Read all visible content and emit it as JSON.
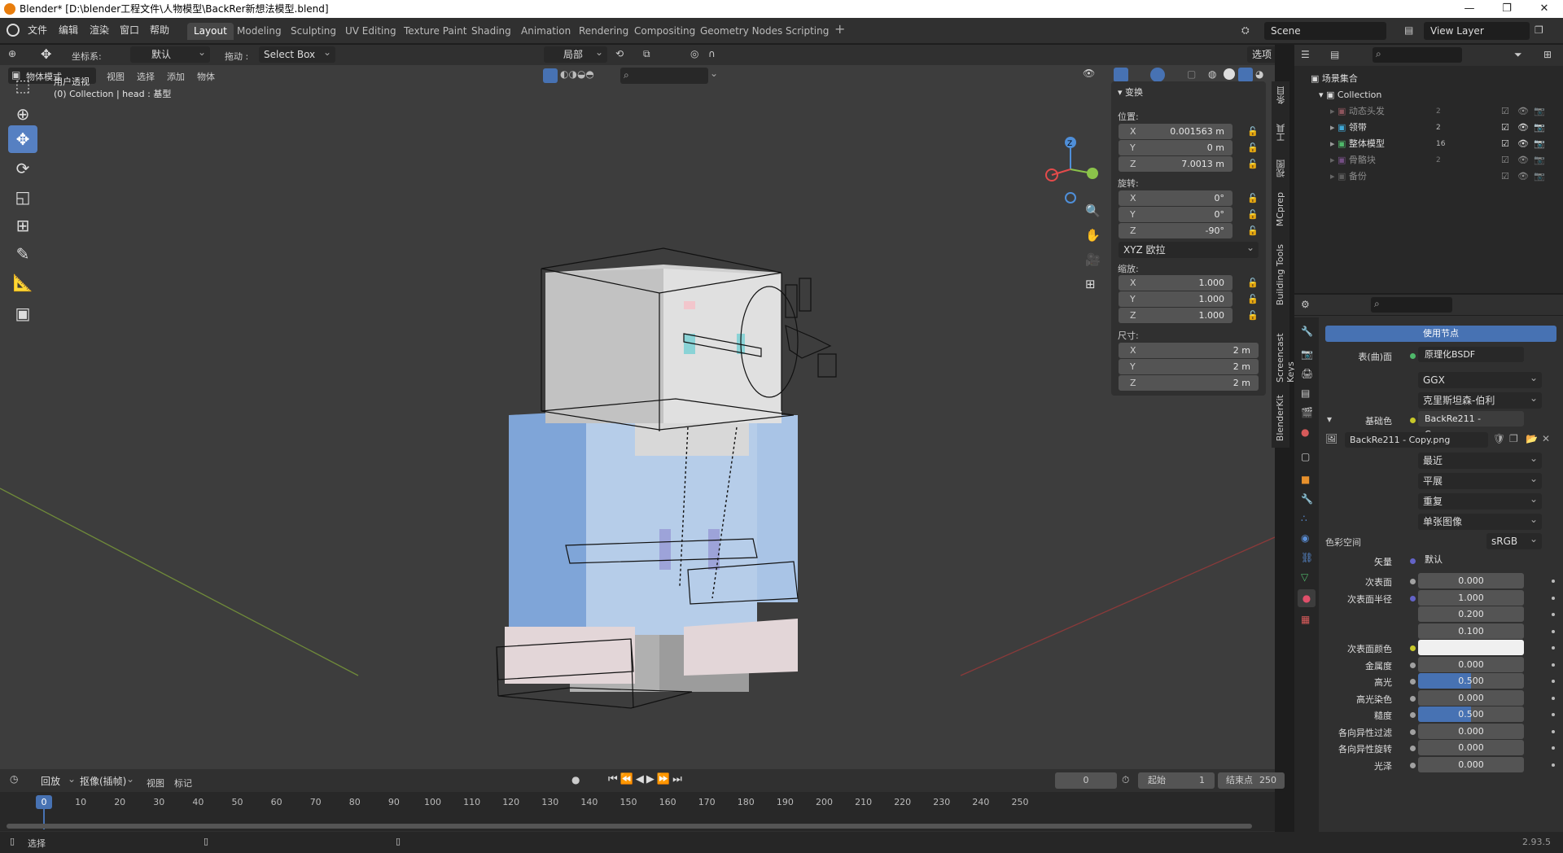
{
  "window": {
    "title": "Blender* [D:\\blender工程文件\\人物模型\\BackRer新想法模型.blend]"
  },
  "menu": [
    "文件",
    "编辑",
    "渲染",
    "窗口",
    "帮助"
  ],
  "workspaces": [
    "Layout",
    "Modeling",
    "Sculpting",
    "UV Editing",
    "Texture Paint",
    "Shading",
    "Animation",
    "Rendering",
    "Compositing",
    "Geometry Nodes",
    "Scripting"
  ],
  "active_workspace": "Layout",
  "scene": "Scene",
  "view_layer": "View Layer",
  "tool_header": {
    "coord_label": "坐标系:",
    "coord_value": "默认",
    "drag_label": "拖动 :",
    "drag_value": "Select Box",
    "pivot": "局部",
    "options": "选项"
  },
  "viewport_header": {
    "mode": "物体模式",
    "menus": [
      "视图",
      "选择",
      "添加",
      "物体"
    ]
  },
  "viewport_info": {
    "line1": "用户透视",
    "line2": "(0) Collection | head : 基型"
  },
  "gizmo": {
    "x": "X",
    "y": "Y",
    "z": "Z"
  },
  "transform": {
    "title": "变换",
    "location_label": "位置:",
    "location": [
      {
        "axis": "X",
        "value": "0.001563 m"
      },
      {
        "axis": "Y",
        "value": "0 m"
      },
      {
        "axis": "Z",
        "value": "7.0013 m"
      }
    ],
    "rotation_label": "旋转:",
    "rotation": [
      {
        "axis": "X",
        "value": "0°"
      },
      {
        "axis": "Y",
        "value": "0°"
      },
      {
        "axis": "Z",
        "value": "-90°"
      }
    ],
    "rotation_mode": "XYZ 欧拉",
    "scale_label": "缩放:",
    "scale": [
      {
        "axis": "X",
        "value": "1.000"
      },
      {
        "axis": "Y",
        "value": "1.000"
      },
      {
        "axis": "Z",
        "value": "1.000"
      }
    ],
    "dimensions_label": "尺寸:",
    "dimensions": [
      {
        "axis": "X",
        "value": "2 m"
      },
      {
        "axis": "Y",
        "value": "2 m"
      },
      {
        "axis": "Z",
        "value": "2 m"
      }
    ]
  },
  "side_tabs": [
    "条目",
    "工具",
    "视图",
    "MCprep",
    "Building Tools",
    "Screencast Keys",
    "BlenderKit"
  ],
  "outliner": {
    "root": "场景集合",
    "collection": "Collection",
    "items": [
      {
        "name": "动态头发",
        "dim": true,
        "badge": "2"
      },
      {
        "name": "领带",
        "dim": false,
        "badge": "2"
      },
      {
        "name": "整体模型",
        "dim": false,
        "badge": "16"
      },
      {
        "name": "骨骼块",
        "dim": true,
        "badge": "2"
      },
      {
        "name": "备份",
        "dim": true,
        "badge": ""
      }
    ]
  },
  "properties": {
    "use_nodes": "使用节点",
    "surface_label": "表(曲)面",
    "surface_value": "原理化BSDF",
    "distribution": "GGX",
    "subsurface_method": "克里斯坦森-伯利",
    "base_color_label": "基础色",
    "base_color_value": "BackRe211 - Copy.png",
    "image_name": "BackRe211 - Copy.png",
    "interpolation": "最近",
    "projection": "平展",
    "extension": "重复",
    "source": "单张图像",
    "color_space_label": "色彩空间",
    "color_space_value": "sRGB",
    "vector_label": "矢量",
    "vector_value": "默认",
    "rows": [
      {
        "label": "次表面",
        "value": "0.000",
        "color": "#a1a1a1"
      },
      {
        "label": "次表面半径",
        "value": "1.000",
        "color": "#6363c7"
      },
      {
        "label": "",
        "value": "0.200",
        "color": ""
      },
      {
        "label": "",
        "value": "0.100",
        "color": ""
      },
      {
        "label": "次表面颜色",
        "value": "",
        "color": "#c7c729"
      },
      {
        "label": "金属度",
        "value": "0.000",
        "color": "#a1a1a1"
      },
      {
        "label": "高光",
        "value": "0.500",
        "color": "#a1a1a1",
        "fill": 0.5
      },
      {
        "label": "高光染色",
        "value": "0.000",
        "color": "#a1a1a1"
      },
      {
        "label": "糙度",
        "value": "0.500",
        "color": "#a1a1a1",
        "fill": 0.5
      },
      {
        "label": "各向异性过滤",
        "value": "0.000",
        "color": "#a1a1a1"
      },
      {
        "label": "各向异性旋转",
        "value": "0.000",
        "color": "#a1a1a1"
      },
      {
        "label": "光泽",
        "value": "0.000",
        "color": "#a1a1a1"
      }
    ]
  },
  "timeline": {
    "menus": [
      "回放",
      "抠像(插帧)",
      "视图",
      "标记"
    ],
    "current_frame": "0",
    "start_label": "起始",
    "start": "1",
    "end_label": "结束点",
    "end": "250",
    "ticks": [
      "0",
      "10",
      "20",
      "30",
      "40",
      "50",
      "60",
      "70",
      "80",
      "90",
      "100",
      "110",
      "120",
      "130",
      "140",
      "150",
      "160",
      "170",
      "180",
      "190",
      "200",
      "210",
      "220",
      "230",
      "240",
      "250"
    ]
  },
  "status": {
    "select": "选择",
    "version": "2.93.5"
  },
  "colors": {
    "accent": "#4772b3",
    "active_tool": "#5680c2",
    "x_axis": "#e44b4b",
    "y_axis": "#8bc34a",
    "z_axis": "#4f8fd9"
  }
}
